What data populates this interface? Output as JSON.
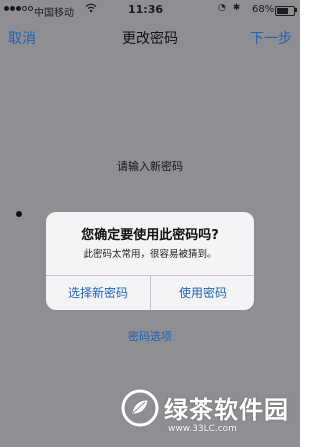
{
  "status_bar": {
    "carrier": "中国移动",
    "wifi_icon": "wifi-icon",
    "time": "11:36",
    "icons": "◔ ✱",
    "battery_text": "68%",
    "battery_level": 0.68
  },
  "nav": {
    "cancel_label": "取消",
    "title": "更改密码",
    "next_label": "下一步"
  },
  "content": {
    "prompt": "请输入新密码",
    "password_dot_count": 1,
    "options_link": "密码选项"
  },
  "alert": {
    "title": "您确定要使用此密码吗?",
    "message": "此密码太常用，很容易被猜到。",
    "choose_new_label": "选择新密码",
    "use_label": "使用密码"
  },
  "watermark": {
    "name": "绿茶软件园",
    "url": "www.33LC.com"
  },
  "colors": {
    "accent": "#1e61b8",
    "dim_background": "#8e8e93",
    "alert_background": "#f4f4f6"
  }
}
